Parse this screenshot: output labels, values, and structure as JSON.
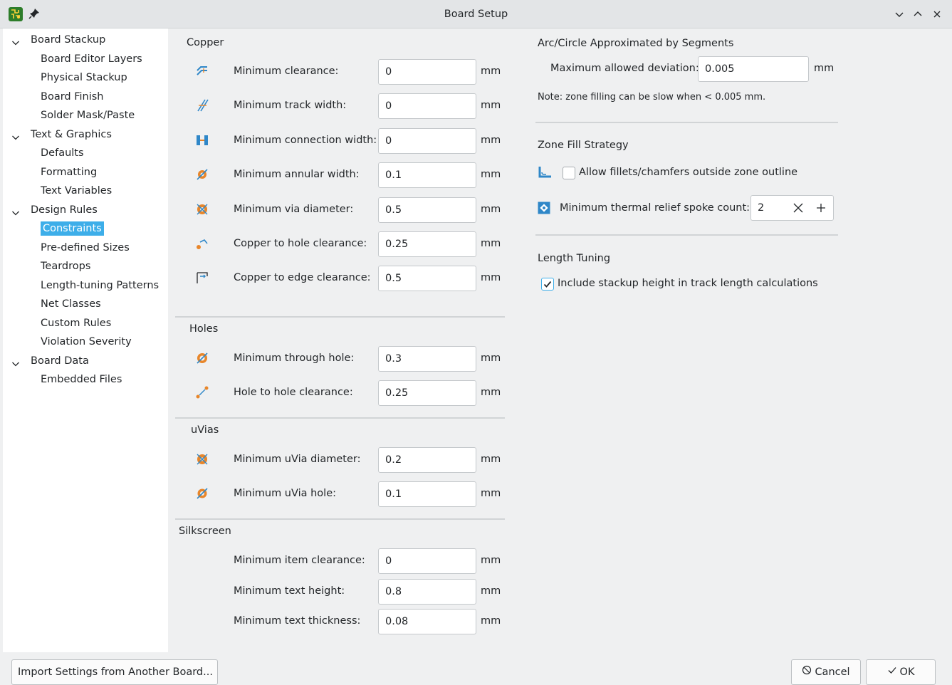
{
  "window": {
    "title": "Board Setup"
  },
  "sidebar": {
    "items": [
      {
        "label": "Board Stackup",
        "level": 0,
        "expanded": true
      },
      {
        "label": "Board Editor Layers",
        "level": 1
      },
      {
        "label": "Physical Stackup",
        "level": 1
      },
      {
        "label": "Board Finish",
        "level": 1
      },
      {
        "label": "Solder Mask/Paste",
        "level": 1
      },
      {
        "label": "Text & Graphics",
        "level": 0,
        "expanded": true
      },
      {
        "label": "Defaults",
        "level": 1
      },
      {
        "label": "Formatting",
        "level": 1
      },
      {
        "label": "Text Variables",
        "level": 1
      },
      {
        "label": "Design Rules",
        "level": 0,
        "expanded": true
      },
      {
        "label": "Constraints",
        "level": 1,
        "selected": true
      },
      {
        "label": "Pre-defined Sizes",
        "level": 1
      },
      {
        "label": "Teardrops",
        "level": 1
      },
      {
        "label": "Length-tuning Patterns",
        "level": 1
      },
      {
        "label": "Net Classes",
        "level": 1
      },
      {
        "label": "Custom Rules",
        "level": 1
      },
      {
        "label": "Violation Severity",
        "level": 1
      },
      {
        "label": "Board Data",
        "level": 0,
        "expanded": true
      },
      {
        "label": "Embedded Files",
        "level": 1
      }
    ]
  },
  "copper": {
    "title": "Copper",
    "rows": [
      {
        "label": "Minimum clearance:",
        "value": "0",
        "unit": "mm",
        "icon": "clearance-icon"
      },
      {
        "label": "Minimum track width:",
        "value": "0",
        "unit": "mm",
        "icon": "track-width-icon"
      },
      {
        "label": "Minimum connection width:",
        "value": "0",
        "unit": "mm",
        "icon": "connection-width-icon"
      },
      {
        "label": "Minimum annular width:",
        "value": "0.1",
        "unit": "mm",
        "icon": "annular-width-icon"
      },
      {
        "label": "Minimum via diameter:",
        "value": "0.5",
        "unit": "mm",
        "icon": "via-diameter-icon"
      },
      {
        "label": "Copper to hole clearance:",
        "value": "0.25",
        "unit": "mm",
        "icon": "hole-clearance-icon"
      },
      {
        "label": "Copper to edge clearance:",
        "value": "0.5",
        "unit": "mm",
        "icon": "edge-clearance-icon"
      }
    ]
  },
  "holes": {
    "title": "Holes",
    "rows": [
      {
        "label": "Minimum through hole:",
        "value": "0.3",
        "unit": "mm",
        "icon": "through-hole-icon"
      },
      {
        "label": "Hole to hole clearance:",
        "value": "0.25",
        "unit": "mm",
        "icon": "hole-to-hole-icon"
      }
    ]
  },
  "uvias": {
    "title": "uVias",
    "rows": [
      {
        "label": "Minimum uVia diameter:",
        "value": "0.2",
        "unit": "mm",
        "icon": "uvia-diameter-icon"
      },
      {
        "label": "Minimum uVia hole:",
        "value": "0.1",
        "unit": "mm",
        "icon": "uvia-hole-icon"
      }
    ]
  },
  "silkscreen": {
    "title": "Silkscreen",
    "rows": [
      {
        "label": "Minimum item clearance:",
        "value": "0",
        "unit": "mm"
      },
      {
        "label": "Minimum text height:",
        "value": "0.8",
        "unit": "mm"
      },
      {
        "label": "Minimum text thickness:",
        "value": "0.08",
        "unit": "mm"
      }
    ]
  },
  "arc": {
    "title": "Arc/Circle Approximated by Segments",
    "label": "Maximum allowed deviation:",
    "value": "0.005",
    "unit": "mm",
    "note": "Note: zone filling can be slow when < 0.005 mm."
  },
  "zone_fill": {
    "title": "Zone Fill Strategy",
    "fillets_label": "Allow fillets/chamfers outside zone outline",
    "fillets_checked": false,
    "spoke_label": "Minimum thermal relief spoke count:",
    "spoke_value": "2"
  },
  "length_tuning": {
    "title": "Length Tuning",
    "stackup_label": "Include stackup height in track length calculations",
    "stackup_checked": true
  },
  "buttons": {
    "import": "Import Settings from Another Board...",
    "cancel": "Cancel",
    "ok": "OK"
  },
  "colors": {
    "accent": "#3daee9",
    "icon_orange": "#e8862a",
    "icon_blue": "#2f87c8"
  }
}
